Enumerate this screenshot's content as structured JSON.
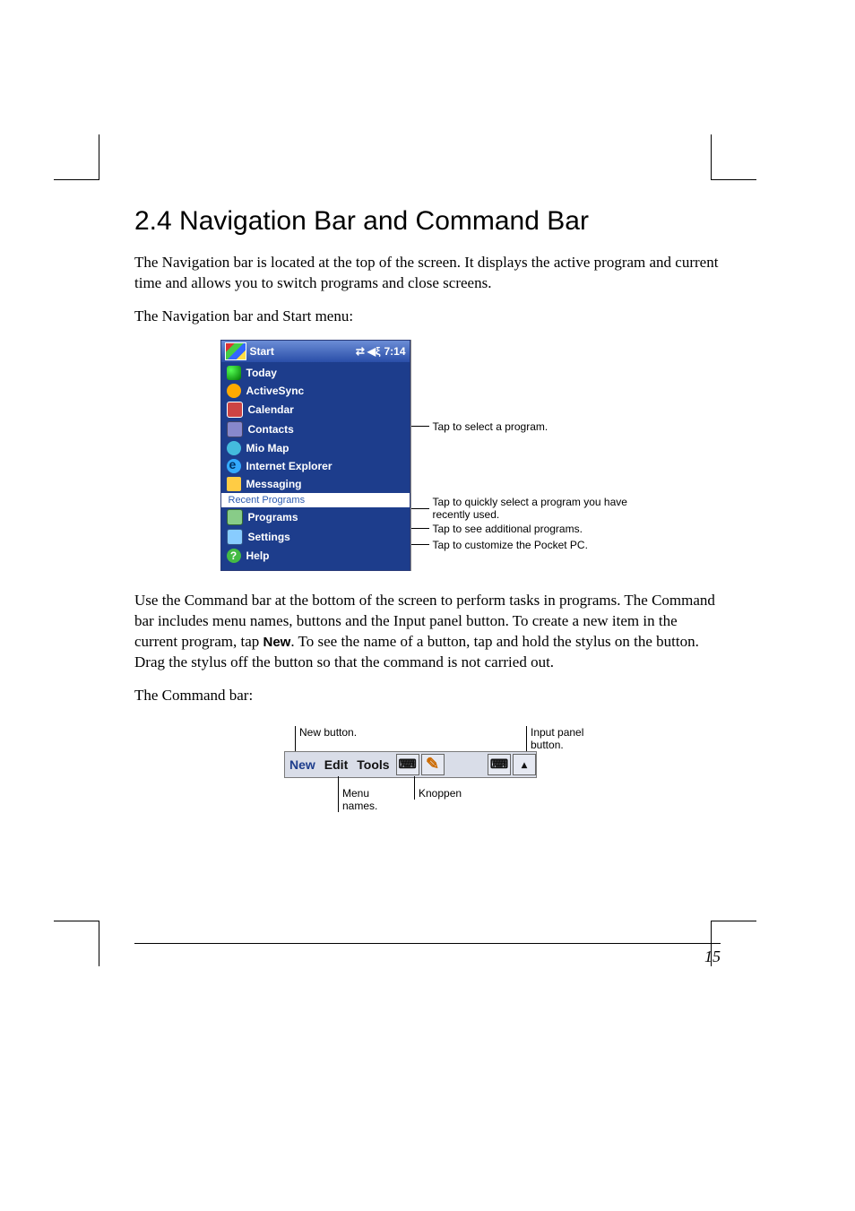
{
  "heading": "2.4   Navigation Bar and Command Bar",
  "para1": "The Navigation bar is located at the top of the screen. It displays the active program and current time and allows you to switch programs and close screens.",
  "para2": "The Navigation bar and Start menu:",
  "para3a": "Use the Command bar at the bottom of the screen to perform tasks in programs. The Command bar includes menu names, buttons and the Input panel button. To create a new item in the current program, tap ",
  "para3_bold": "New",
  "para3b": ". To see the name of a button, tap and hold the stylus on the button. Drag the stylus off the button so that the command is not carried out.",
  "para4": "The Command bar:",
  "pageNumber": "15",
  "fig1": {
    "titlebarLabel": "Start",
    "time": "7:14",
    "speakerGlyph": "◀ξ",
    "menu": {
      "today": "Today",
      "activesync": "ActiveSync",
      "calendar": "Calendar",
      "contacts": "Contacts",
      "mioMap": "Mio Map",
      "ie": "Internet Explorer",
      "messaging": "Messaging",
      "recent": "Recent Programs",
      "programs": "Programs",
      "settings": "Settings",
      "help": "Help"
    },
    "callouts": {
      "selectProgram": "Tap to select a program.",
      "recent": "Tap to quickly select a program you have recently used.",
      "programs": "Tap to see additional programs.",
      "settings": "Tap to customize the Pocket PC."
    }
  },
  "fig2": {
    "labels": {
      "newButton": "New button.",
      "inputPanel": "Input panel button.",
      "menuNames": "Menu names.",
      "knoppen": "Knoppen"
    },
    "bar": {
      "new": "New",
      "edit": "Edit",
      "tools": "Tools"
    }
  }
}
